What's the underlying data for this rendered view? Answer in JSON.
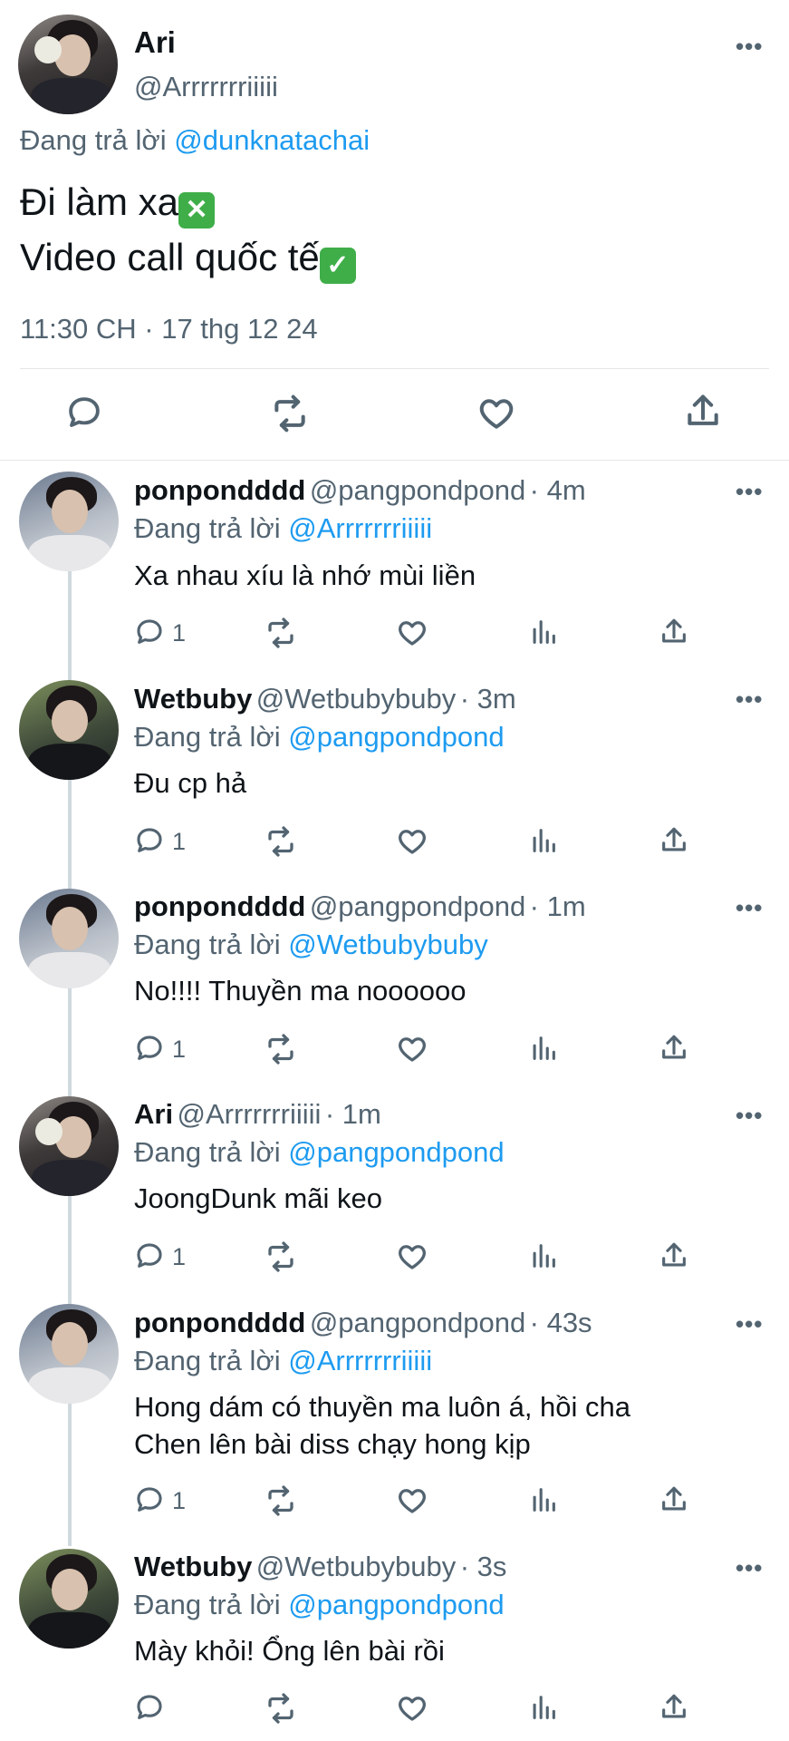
{
  "main_tweet": {
    "author_name": "Ari",
    "author_handle": "@Arrrrrrriiiii",
    "replying_prefix": "Đang trả lời",
    "replying_to": "@dunknatachai",
    "text_line1": "Đi làm xa",
    "text_line2": "Video call quốc tế",
    "emoji1": "✕",
    "emoji2": "✓",
    "timestamp": "11:30 CH · 17 thg 12 24",
    "more_label": "•••"
  },
  "replies": [
    {
      "name": "ponpondddd",
      "handle": "@pangpondpond",
      "time": "· 4m",
      "replying_prefix": "Đang trả lời",
      "replying_to": "@Arrrrrrriiiii",
      "text": "Xa nhau xíu là nhớ mùi liền",
      "text2": "",
      "reply_count": "1"
    },
    {
      "name": "Wetbuby",
      "handle": "@Wetbubybuby",
      "time": "· 3m",
      "replying_prefix": "Đang trả lời",
      "replying_to": "@pangpondpond",
      "text": "Đu cp hả",
      "text2": "",
      "reply_count": "1"
    },
    {
      "name": "ponpondddd",
      "handle": "@pangpondpond",
      "time": "· 1m",
      "replying_prefix": "Đang trả lời",
      "replying_to": "@Wetbubybuby",
      "text": "No!!!! Thuyền ma noooooo",
      "text2": "",
      "reply_count": "1"
    },
    {
      "name": "Ari",
      "handle": "@Arrrrrrriiiii",
      "time": "· 1m",
      "replying_prefix": "Đang trả lời",
      "replying_to": "@pangpondpond",
      "text": "JoongDunk mãi keo",
      "text2": "",
      "reply_count": "1"
    },
    {
      "name": "ponpondddd",
      "handle": "@pangpondpond",
      "time": "· 43s",
      "replying_prefix": "Đang trả lời",
      "replying_to": "@Arrrrrrriiiii",
      "text": "Hong dám có thuyền ma luôn á, hồi cha",
      "text2": "Chen lên bài diss chạy hong kịp",
      "reply_count": "1"
    },
    {
      "name": "Wetbuby",
      "handle": "@Wetbubybuby",
      "time": "· 3s",
      "replying_prefix": "Đang trả lời",
      "replying_to": "@pangpondpond",
      "text": "Mày khỏi! Ổng lên bài rồi",
      "text2": "",
      "reply_count": ""
    }
  ],
  "more_label": "•••",
  "colors": {
    "link": "#1d9bf0",
    "muted": "#536471",
    "text": "#0f1419",
    "emoji_red": "#35a84a",
    "emoji_check": "#35a84a"
  }
}
